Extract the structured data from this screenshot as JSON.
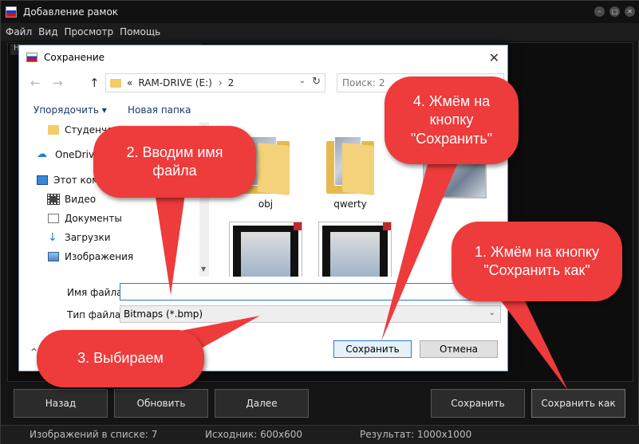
{
  "app": {
    "title": "Добавление рамок",
    "menu": [
      "Файл",
      "Вид",
      "Просмотр",
      "Помощь"
    ],
    "tab_fragment": "Н",
    "buttons": {
      "back": "Назад",
      "refresh": "Обновить",
      "next": "Далее",
      "save": "Сохранить",
      "save_as": "Сохранить как"
    },
    "status": {
      "count": "Изображений в списке: 7",
      "source": "Исходник: 600x600",
      "result": "Результат: 1000x1000"
    }
  },
  "dialog": {
    "title": "Сохранение",
    "close_glyph": "✕",
    "address": {
      "prefix": "«",
      "drive": "RAM-DRIVE (E:)",
      "separator": "›",
      "folder": "2"
    },
    "search_placeholder": "Поиск: 2",
    "toolbar": {
      "organize": "Упорядочить ▾",
      "new_folder": "Новая папка"
    },
    "nav_items": [
      {
        "label": "Студенческ",
        "icon": "folder-icon"
      },
      {
        "label": "OneDrive",
        "icon": "cloud-icon"
      },
      {
        "label": "Этот компьют",
        "icon": "computer-icon"
      },
      {
        "label": "Видео",
        "icon": "video-icon"
      },
      {
        "label": "Документы",
        "icon": "document-icon"
      },
      {
        "label": "Загрузки",
        "icon": "download-icon"
      },
      {
        "label": "Изображения",
        "icon": "pictures-icon"
      }
    ],
    "files": [
      {
        "label": "obj",
        "kind": "folder"
      },
      {
        "label": "qwerty",
        "kind": "folder"
      }
    ],
    "filename_label": "Имя файла:",
    "filename_value": "",
    "filetype_label": "Тип файла:",
    "filetype_value": "Bitmaps (*.bmp)",
    "save_button": "Сохранить",
    "cancel_button": "Отмена"
  },
  "callouts": {
    "step1": "1. Жмём на кнопку \"Сохранить как\"",
    "step2": "2. Вводим имя файла",
    "step3": "3. Выбираем",
    "step4": "4. Жмём на кнопку \"Сохранить\""
  },
  "colors": {
    "callout": "#ee3b3b",
    "dialog_accent": "#2a78d6",
    "app_bg": "#141414"
  }
}
